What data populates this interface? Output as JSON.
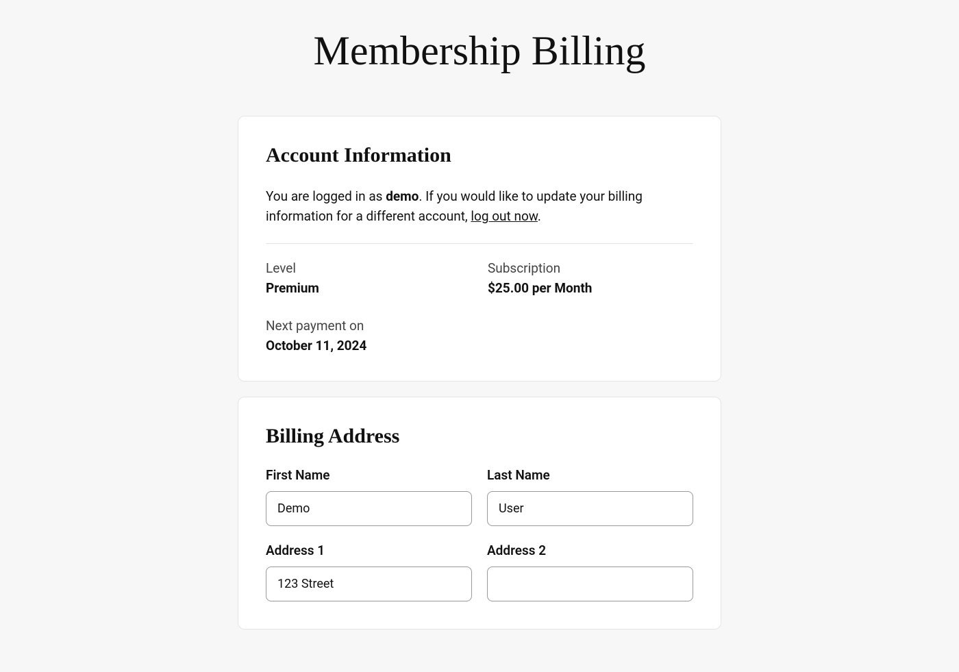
{
  "page_title": "Membership Billing",
  "account_info": {
    "title": "Account Information",
    "logged_in_prefix": "You are logged in as ",
    "username": "demo",
    "logged_in_suffix": ". If you would like to update your billing information for a different account, ",
    "logout_link": "log out now",
    "logged_in_end": ".",
    "level_label": "Level",
    "level_value": "Premium",
    "subscription_label": "Subscription",
    "subscription_value": "$25.00 per Month",
    "next_payment_label": "Next payment on",
    "next_payment_value": "October 11, 2024"
  },
  "billing_address": {
    "title": "Billing Address",
    "first_name_label": "First Name",
    "first_name_value": "Demo",
    "last_name_label": "Last Name",
    "last_name_value": "User",
    "address1_label": "Address 1",
    "address1_value": "123 Street",
    "address2_label": "Address 2",
    "address2_value": ""
  }
}
